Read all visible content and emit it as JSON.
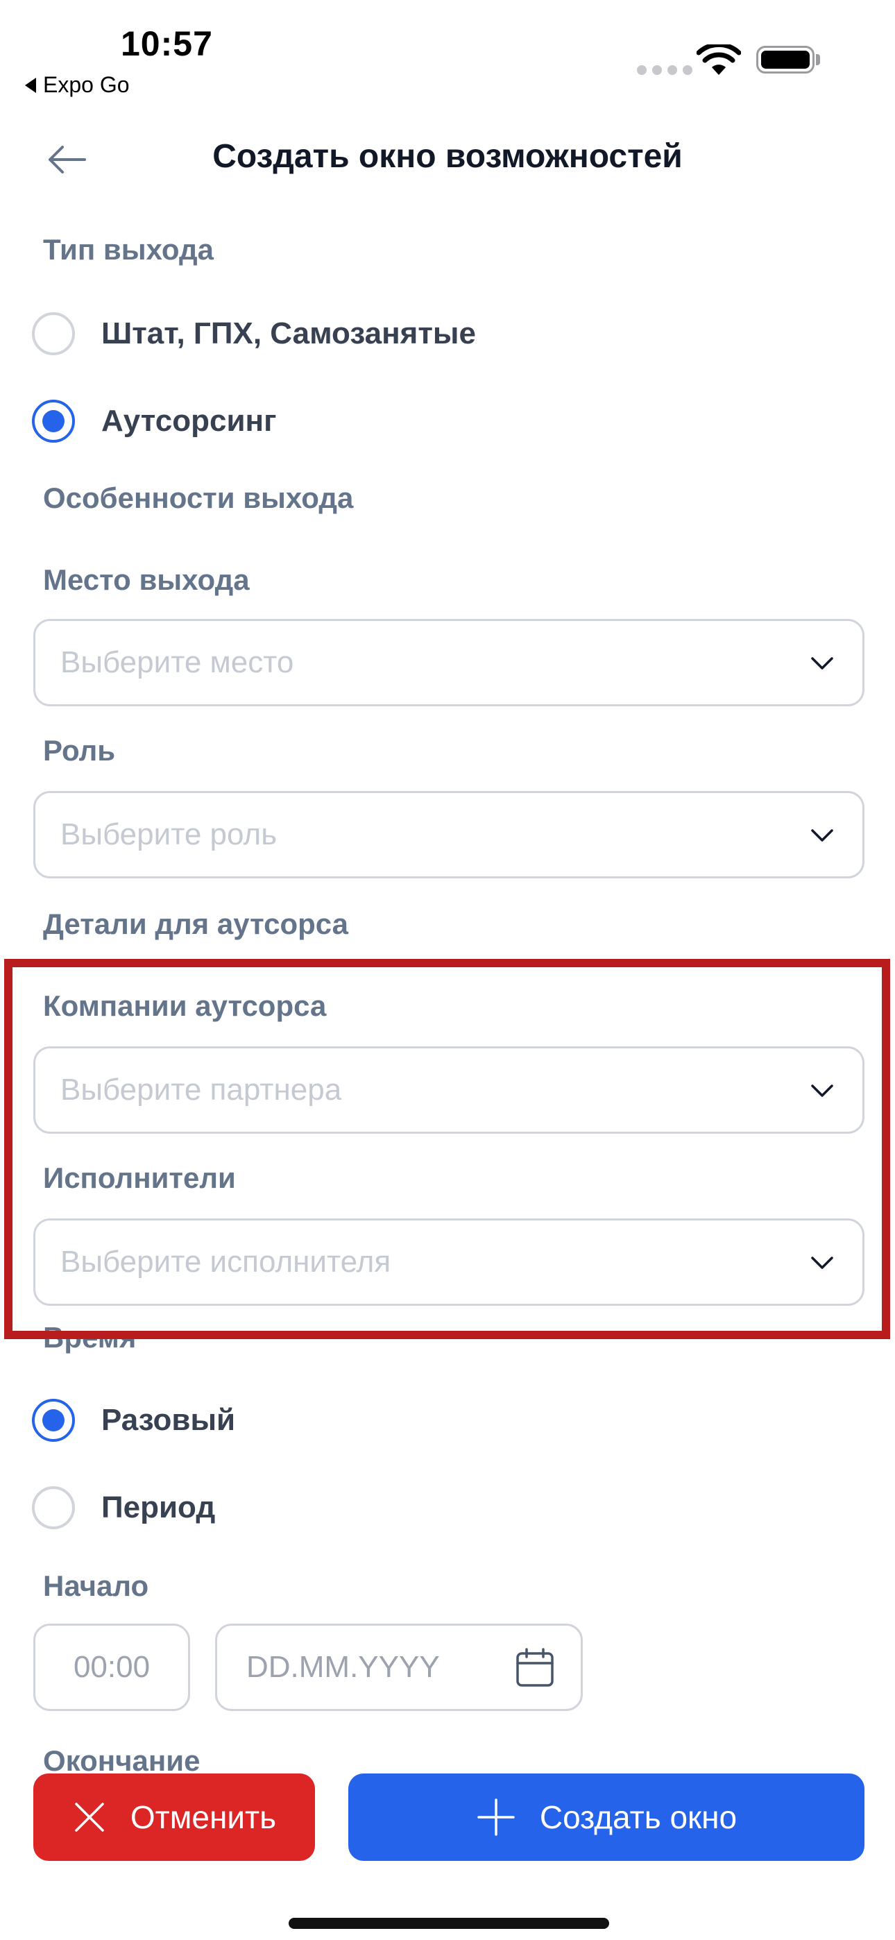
{
  "status_bar": {
    "time": "10:57",
    "back_app": "Expo Go"
  },
  "header": {
    "title": "Создать окно возможностей"
  },
  "exit_type": {
    "label": "Тип выхода",
    "options": [
      {
        "label": "Штат, ГПХ, Самозанятые",
        "selected": false
      },
      {
        "label": "Аутсорсинг",
        "selected": true
      }
    ]
  },
  "exit_features": {
    "label": "Особенности выхода"
  },
  "place": {
    "label": "Место выхода",
    "placeholder": "Выберите место"
  },
  "role": {
    "label": "Роль",
    "placeholder": "Выберите роль"
  },
  "outsource_details": {
    "label": "Детали для аутсорса"
  },
  "companies": {
    "label": "Компании аутсорса",
    "placeholder": "Выберите партнера"
  },
  "executors": {
    "label": "Исполнители",
    "placeholder": "Выберите исполнителя"
  },
  "time": {
    "label": "Время",
    "options": [
      {
        "label": "Разовый",
        "selected": true
      },
      {
        "label": "Период",
        "selected": false
      }
    ]
  },
  "start": {
    "label": "Начало",
    "time_placeholder": "00:00",
    "date_placeholder": "DD.MM.YYYY"
  },
  "end": {
    "label": "Окончание"
  },
  "actions": {
    "cancel": "Отменить",
    "create": "Создать окно"
  },
  "colors": {
    "accent": "#2563eb",
    "danger": "#dc2626",
    "highlight": "#b91c1c",
    "label": "#64748b"
  }
}
